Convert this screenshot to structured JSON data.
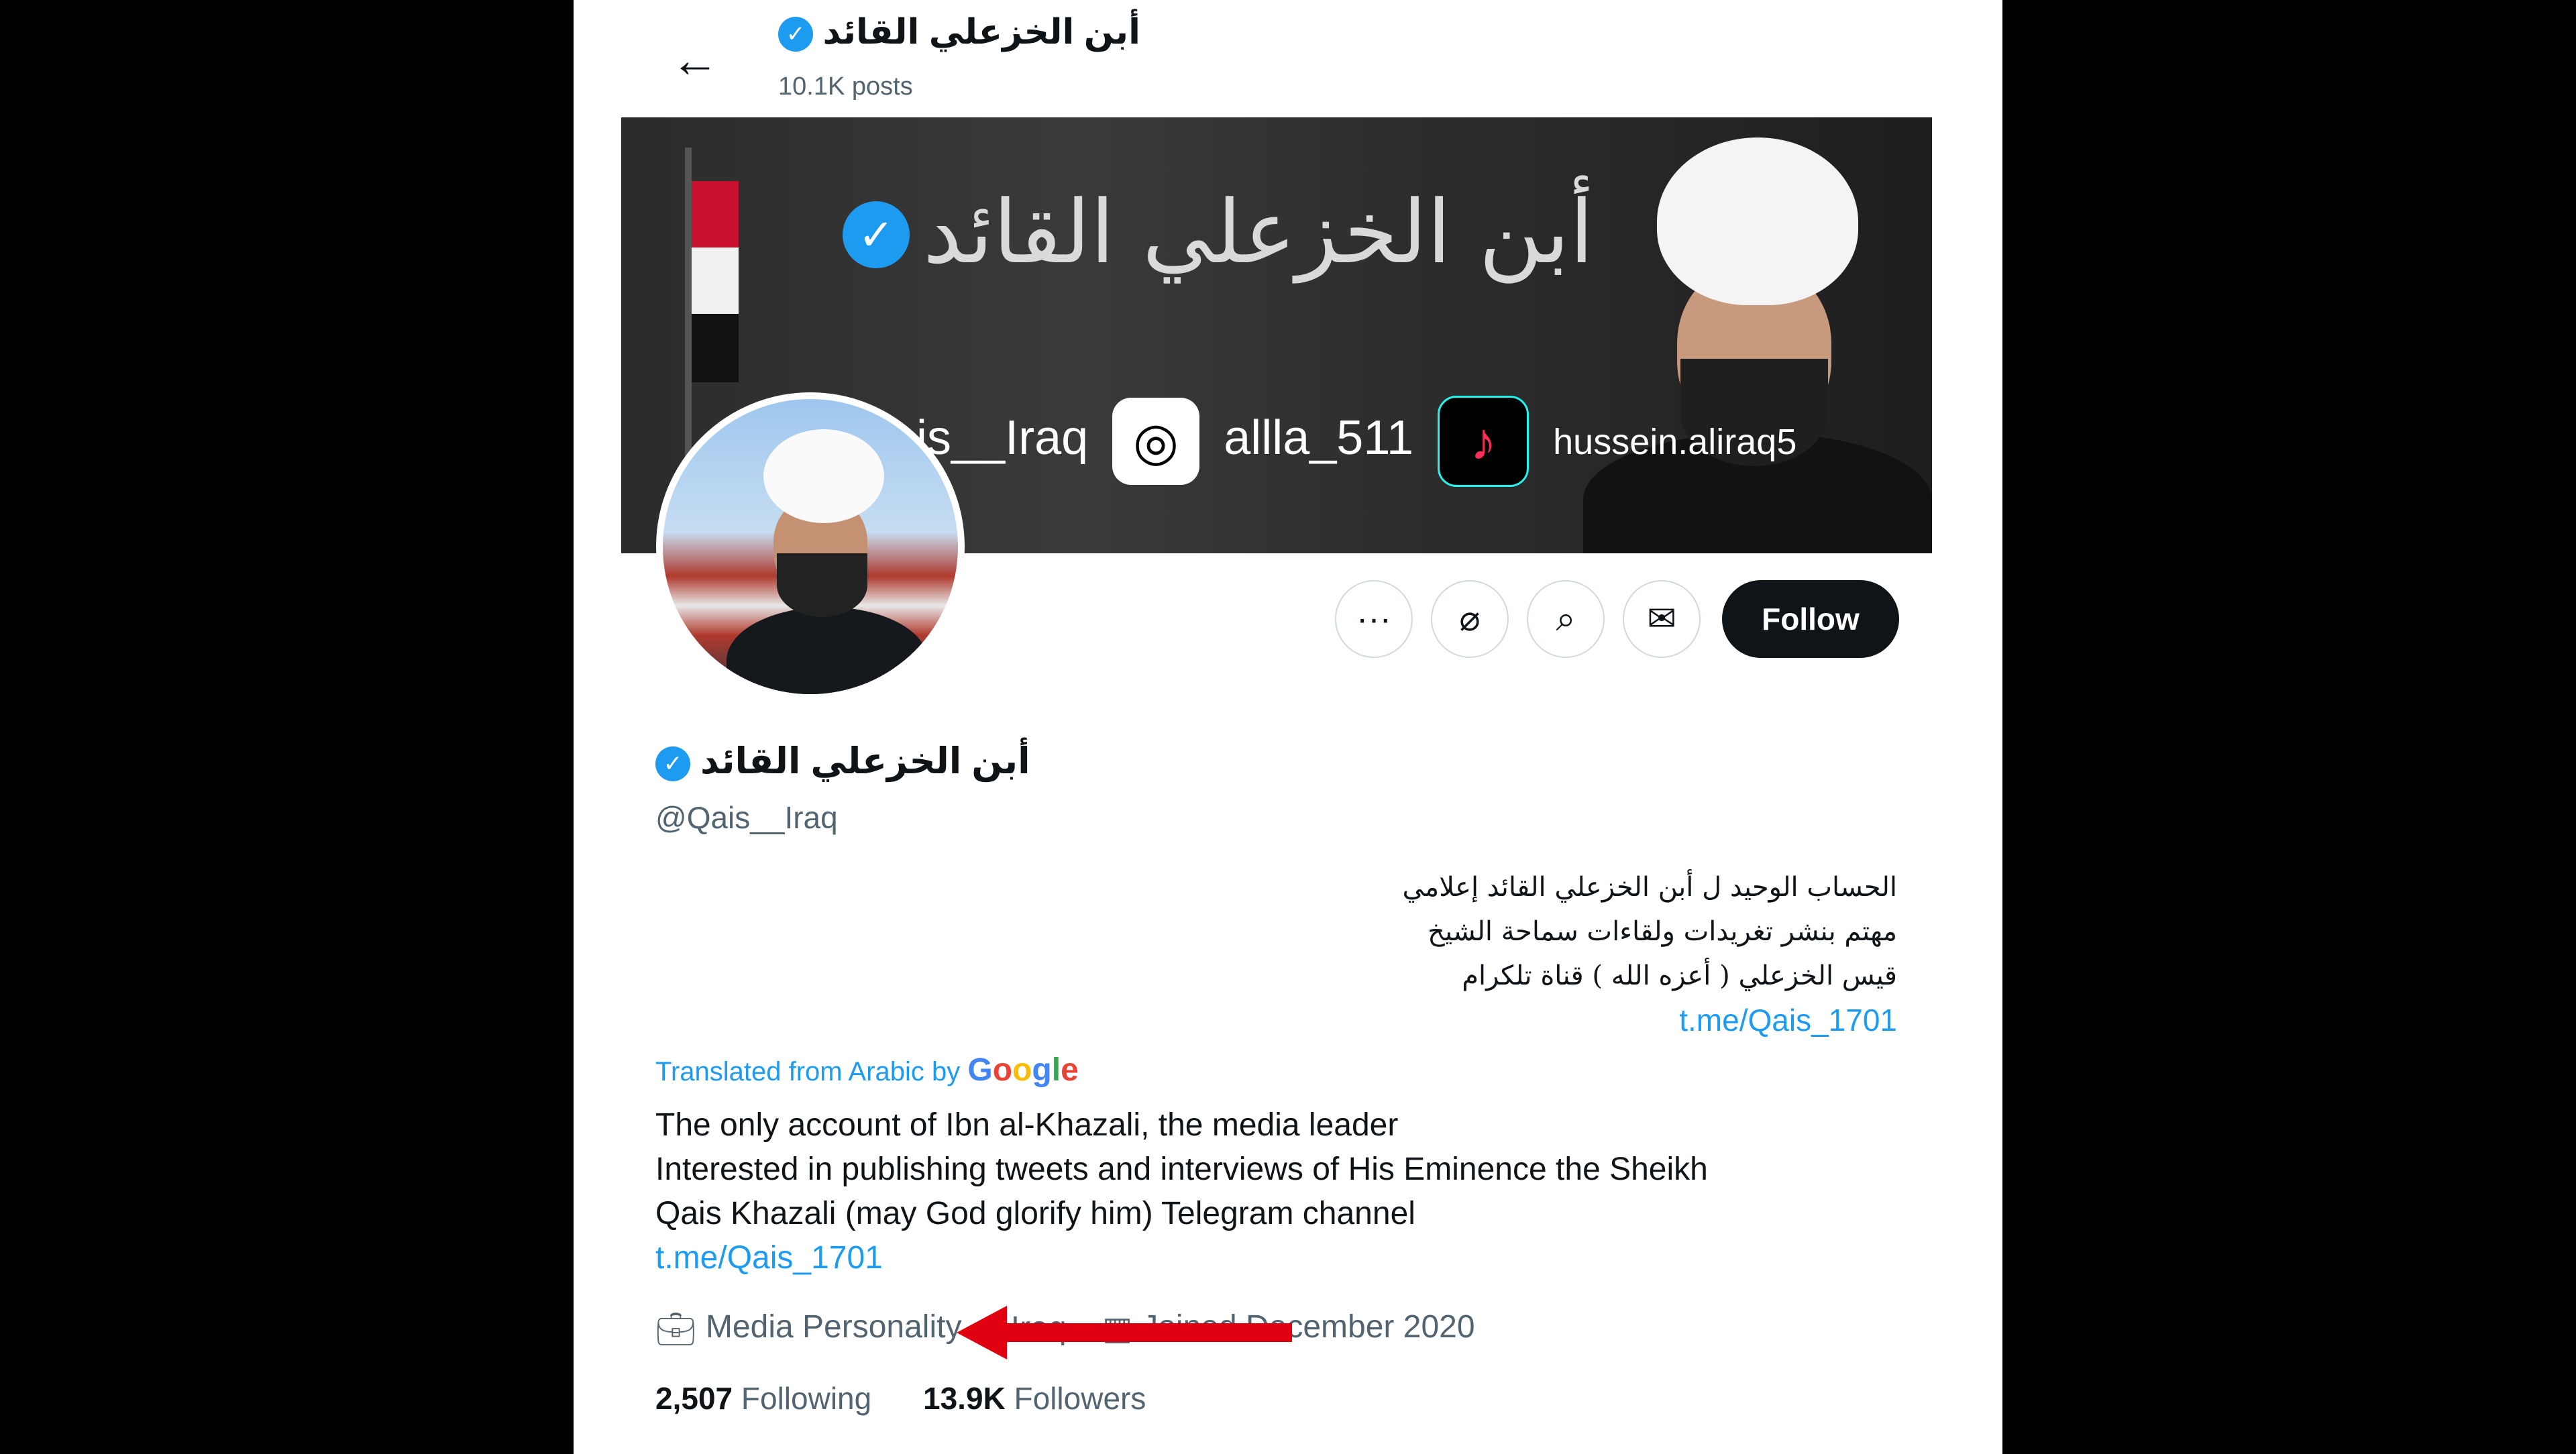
{
  "header": {
    "display_name": "أبن الخزعلي القائد",
    "posts_count": "10.1K posts"
  },
  "banner": {
    "title_art": "أبن الخزعلي القائد",
    "social": [
      {
        "icon": "instagram-icon",
        "text": "is__Iraq"
      },
      {
        "icon": "tiktok-icon",
        "text": "allla_511"
      },
      {
        "text": "hussein.aliraq5"
      }
    ]
  },
  "actions": {
    "more_icon": "···",
    "grok_icon": "⌀",
    "search_icon": "⌕",
    "message_icon": "✉",
    "follow_label": "Follow"
  },
  "profile": {
    "name": "أبن الخزعلي القائد",
    "handle": "@Qais__Iraq",
    "bio_arabic_lines": [
      "الحساب الوحيد ل أبن الخزعلي القائد إعلامي",
      "مهتم بنشر تغريدات ولقاءات سماحة الشيخ",
      "قيس الخزعلي ( أعزه الله ) قناة تلكرام"
    ],
    "bio_arabic_link": "t.me/Qais_1701",
    "translated_label": "Translated from Arabic by",
    "google_letters": [
      "G",
      "o",
      "o",
      "g",
      "l",
      "e"
    ],
    "bio_english_lines": [
      "The only account of Ibn al-Khazali, the media leader",
      "Interested in publishing tweets and interviews of His Eminence the Sheikh",
      "Qais Khazali (may God glorify him) Telegram channel"
    ],
    "bio_english_link": "t.me/Qais_1701",
    "category": "Media Personality",
    "location": "Iraq",
    "joined": "Joined December 2020",
    "following_count": "2,507",
    "following_label": "Following",
    "followers_count": "13.9K",
    "followers_label": "Followers"
  },
  "annotation": {
    "arrow_color": "#e0000f"
  },
  "colors": {
    "accent": "#1d9bf0",
    "verified": "#1d9bf0",
    "text": "#0f1419",
    "muted": "#536471"
  }
}
